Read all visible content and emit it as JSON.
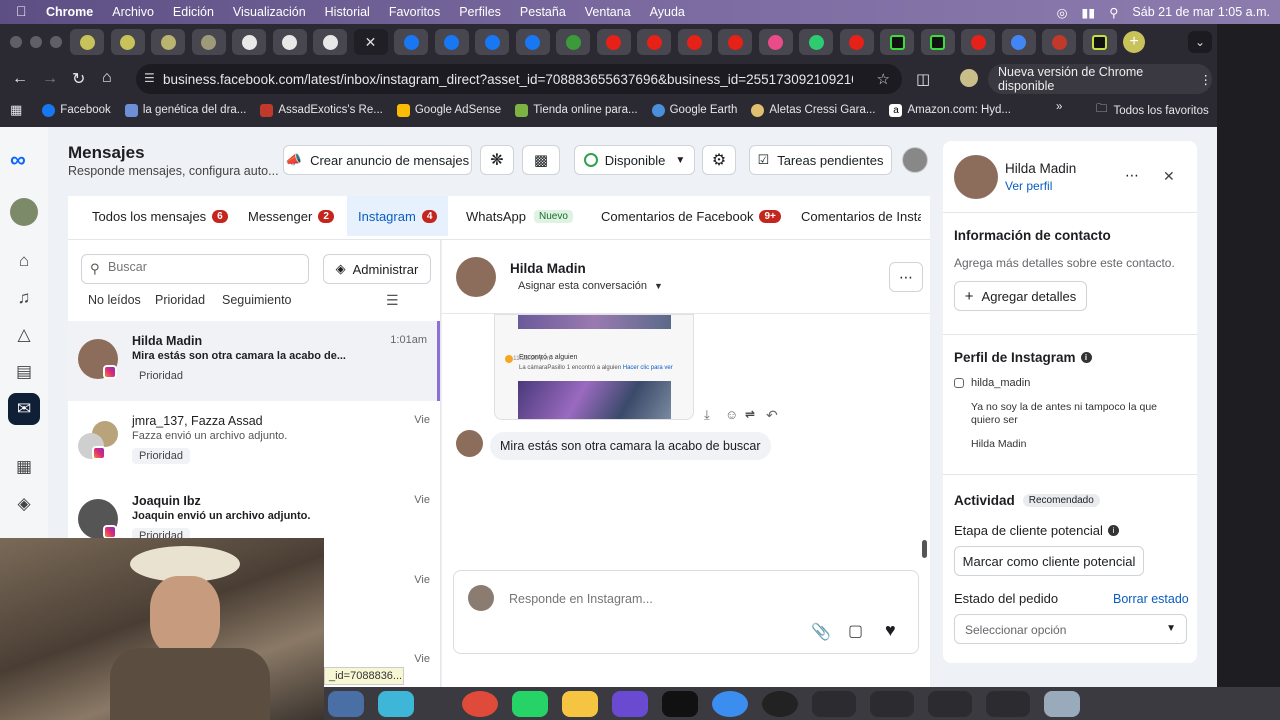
{
  "menubar": {
    "app": "Chrome",
    "items": [
      "Archivo",
      "Edición",
      "Visualización",
      "Historial",
      "Favoritos",
      "Perfiles",
      "Pestaña",
      "Ventana",
      "Ayuda"
    ],
    "clock": "Sáb 21 de mar  1:05 a.m."
  },
  "browser": {
    "url": "business.facebook.com/latest/inbox/instagram_direct?asset_id=708883655637696&business_id=255173092109210&sele...",
    "update_label": "Nueva versión de Chrome disponible",
    "bookmarks": [
      "Facebook",
      "la genética del dra...",
      "AssadExotics's Re...",
      "Google AdSense",
      "Tienda online para...",
      "Google Earth",
      "Aletas Cressi Gara...",
      "Amazon.com: Hyd..."
    ],
    "all_bookmarks": "Todos los favoritos"
  },
  "header": {
    "title": "Mensajes",
    "subtitle": "Responde mensajes, configura auto...",
    "create_ad": "Crear anuncio de mensajes",
    "status": "Disponible",
    "tasks": "Tareas pendientes"
  },
  "tabs": [
    {
      "label": "Todos los mensajes",
      "count": "6"
    },
    {
      "label": "Messenger",
      "count": "2"
    },
    {
      "label": "Instagram",
      "count": "4"
    },
    {
      "label": "WhatsApp",
      "badge": "Nuevo"
    },
    {
      "label": "Comentarios de Facebook",
      "count": "9+"
    },
    {
      "label": "Comentarios de Insta"
    }
  ],
  "list": {
    "search_placeholder": "Buscar",
    "manage": "Administrar",
    "filters": [
      "No leídos",
      "Prioridad",
      "Seguimiento"
    ],
    "items": [
      {
        "name": "Hilda Madin",
        "preview": "Mira estás son otra camara la acabo de...",
        "time": "1:01am",
        "tag": "Prioridad"
      },
      {
        "name": "jmra_137, Fazza Assad",
        "preview": "Fazza envió un archivo adjunto.",
        "time": "Vie",
        "tag": "Prioridad"
      },
      {
        "name": "Joaquin Ibz",
        "preview": "Joaquin envió un archivo adjunto.",
        "time": "Vie",
        "tag": "Prioridad"
      },
      {
        "name": "",
        "preview": "",
        "time": "Vie",
        "tag": ""
      },
      {
        "name": "",
        "preview": "",
        "time": "Vie",
        "tag": ""
      }
    ]
  },
  "chat": {
    "name": "Hilda Madin",
    "assign": "Asignar esta conversación",
    "img_line1": "11:28:20 p.m.",
    "img_line2": "Encontró a alguien",
    "img_line3": "La cámaraPasillo 1 encontró a alguien",
    "img_link": "Hacer clic para ver",
    "message": "Mira estás son otra camara la acabo de buscar",
    "composer_placeholder": "Responde en Instagram..."
  },
  "contact": {
    "name": "Hilda Madin",
    "view_profile": "Ver perfil",
    "info_title": "Información de contacto",
    "info_desc": "Agrega más detalles sobre este contacto.",
    "add_details": "Agregar detalles",
    "ig_title": "Perfil de Instagram",
    "ig_handle": "hilda_madin",
    "ig_bio": "Ya no soy la de antes ni tampoco la que quiero ser",
    "ig_name": "Hilda Madin",
    "activity": "Actividad",
    "recommended": "Recomendado",
    "lead_stage": "Etapa de cliente potencial",
    "mark_lead": "Marcar como cliente potencial",
    "order_status": "Estado del pedido",
    "clear_status": "Borrar estado",
    "select_option": "Seleccionar opción"
  },
  "statusbar": "_id=7088836..."
}
